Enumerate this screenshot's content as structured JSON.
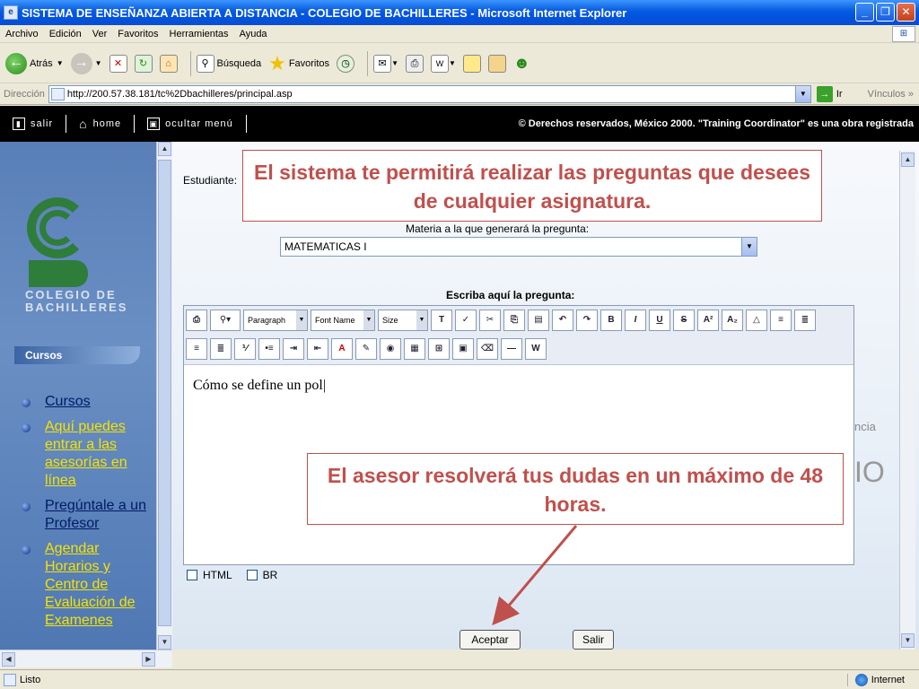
{
  "window": {
    "title": "SISTEMA DE ENSEÑANZA ABIERTA A DISTANCIA - COLEGIO DE BACHILLERES - Microsoft Internet Explorer"
  },
  "menubar": [
    "Archivo",
    "Edición",
    "Ver",
    "Favoritos",
    "Herramientas",
    "Ayuda"
  ],
  "toolbar": {
    "back": "Atrás",
    "search": "Búsqueda",
    "favorites": "Favoritos"
  },
  "address": {
    "label": "Dirección",
    "url": "http://200.57.38.181/tc%2Dbachilleres/principal.asp",
    "go": "Ir",
    "links": "Vínculos"
  },
  "topnav": {
    "salir": "salir",
    "home": "home",
    "ocultar": "ocultar menú",
    "copyright": "© Derechos reservados, México 2000. \"Training Coordinator\" es una obra registrada"
  },
  "sidebar": {
    "logo_text_1": "COLEGIO DE",
    "logo_text_2": "BACHILLERES",
    "section": "Cursos",
    "items": [
      {
        "label": "Cursos",
        "color": "dark"
      },
      {
        "label": "Aquí puedes entrar a las asesorías en línea",
        "color": "yellow"
      },
      {
        "label": "Pregúntale a un Profesor",
        "color": "dark"
      },
      {
        "label": "Agendar Horarios y Centro de Evaluación de Examenes",
        "color": "yellow"
      }
    ]
  },
  "form": {
    "student_label": "Estudiante:",
    "materia_label": "Materia a la que generará la pregunta:",
    "materia_value": "MATEMATICAS I",
    "escriba_label": "Escriba aquí la pregunta:",
    "paragraph": "Paragraph",
    "fontname": "Font Name",
    "size": "Size",
    "editor_text": "Cómo se define un pol",
    "html_label": "HTML",
    "br_label": "BR",
    "accept": "Aceptar",
    "exit": "Salir",
    "decor_1": "ncia",
    "decor_2": "IO"
  },
  "callouts": {
    "first": "El sistema te permitirá realizar las preguntas que desees de cualquier asignatura.",
    "second": "El asesor resolverá tus dudas en un máximo de 48 horas."
  },
  "status": {
    "text": "Listo",
    "zone": "Internet"
  },
  "colors": {
    "callout": "#c0504d",
    "sidebar": "#6a8fc4",
    "yellow_link": "#f5e200",
    "dark_link": "#001a66"
  }
}
